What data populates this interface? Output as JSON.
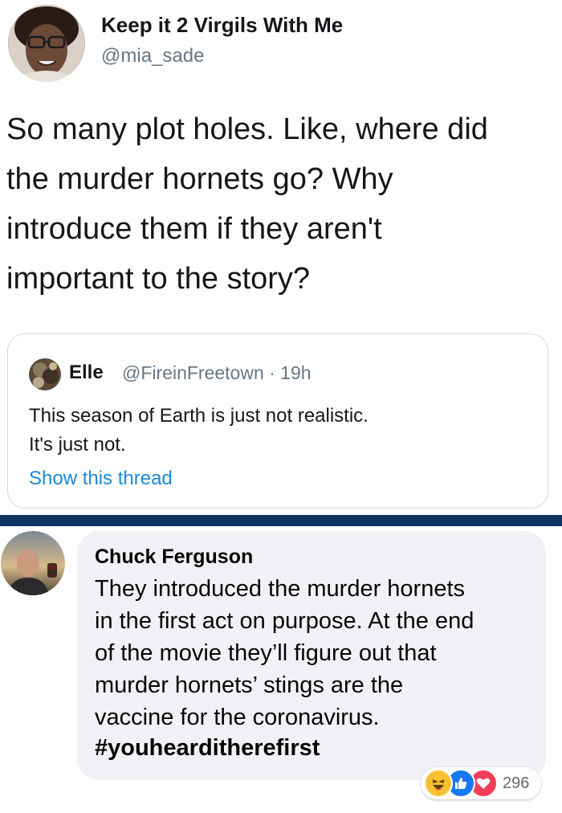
{
  "tweet": {
    "display_name": "Keep it 2 Virgils With Me",
    "handle": "@mia_sade",
    "body": "So many plot holes. Like, where did\nthe murder hornets go? Why\nintroduce them if they aren't\nimportant to the story?",
    "quote": {
      "name": "Elle",
      "meta": "@FireinFreetown · 19h",
      "text": "This season of Earth is just not realistic.\nIt's just not.",
      "link": "Show this thread"
    }
  },
  "colors": {
    "divider": "#0e3362",
    "twitter_link": "#1b8ad8",
    "fb_bubble": "#f0f2f5"
  },
  "comment": {
    "name": "Chuck Ferguson",
    "text": "They introduced the murder hornets\nin the first act on purpose. At the end\nof the movie they’ll figure out that\nmurder hornets’ stings are the\nvaccine for the coronavirus.",
    "hashtag": "#youhearditherefirst",
    "reactions": {
      "icons": [
        "haha-icon",
        "like-icon",
        "love-icon"
      ],
      "count": "296"
    }
  }
}
